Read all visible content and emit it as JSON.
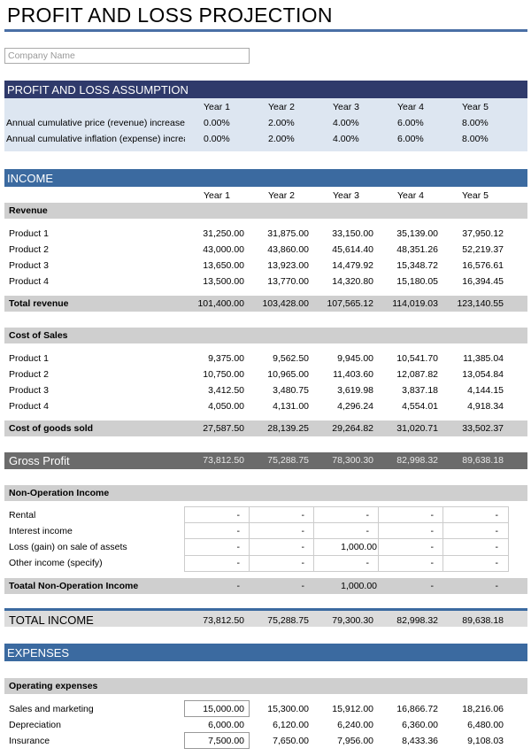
{
  "title": "PROFIT AND LOSS PROJECTION",
  "company_placeholder": "Company Name",
  "assumption": {
    "header": "PROFIT AND LOSS ASSUMPTION",
    "years": [
      "Year 1",
      "Year 2",
      "Year 3",
      "Year 4",
      "Year 5"
    ],
    "rows": [
      {
        "label": "Annual cumulative price (revenue) increase",
        "values": [
          "0.00%",
          "2.00%",
          "4.00%",
          "6.00%",
          "8.00%"
        ]
      },
      {
        "label": "Annual cumulative inflation (expense) increase",
        "values": [
          "0.00%",
          "2.00%",
          "4.00%",
          "6.00%",
          "8.00%"
        ]
      }
    ]
  },
  "income": {
    "header": "INCOME",
    "years": [
      "Year 1",
      "Year 2",
      "Year 3",
      "Year 4",
      "Year 5"
    ],
    "revenue_label": "Revenue",
    "revenue_rows": [
      {
        "label": "Product 1",
        "values": [
          "31,250.00",
          "31,875.00",
          "33,150.00",
          "35,139.00",
          "37,950.12"
        ]
      },
      {
        "label": "Product 2",
        "values": [
          "43,000.00",
          "43,860.00",
          "45,614.40",
          "48,351.26",
          "52,219.37"
        ]
      },
      {
        "label": "Product 3",
        "values": [
          "13,650.00",
          "13,923.00",
          "14,479.92",
          "15,348.72",
          "16,576.61"
        ]
      },
      {
        "label": "Product 4",
        "values": [
          "13,500.00",
          "13,770.00",
          "14,320.80",
          "15,180.05",
          "16,394.45"
        ]
      }
    ],
    "total_revenue": {
      "label": "Total revenue",
      "values": [
        "101,400.00",
        "103,428.00",
        "107,565.12",
        "114,019.03",
        "123,140.55"
      ]
    },
    "cost_label": "Cost of Sales",
    "cost_rows": [
      {
        "label": "Product 1",
        "values": [
          "9,375.00",
          "9,562.50",
          "9,945.00",
          "10,541.70",
          "11,385.04"
        ]
      },
      {
        "label": "Product 2",
        "values": [
          "10,750.00",
          "10,965.00",
          "11,403.60",
          "12,087.82",
          "13,054.84"
        ]
      },
      {
        "label": "Product 3",
        "values": [
          "3,412.50",
          "3,480.75",
          "3,619.98",
          "3,837.18",
          "4,144.15"
        ]
      },
      {
        "label": "Product 4",
        "values": [
          "4,050.00",
          "4,131.00",
          "4,296.24",
          "4,554.01",
          "4,918.34"
        ]
      }
    ],
    "cogs": {
      "label": "Cost of goods sold",
      "values": [
        "27,587.50",
        "28,139.25",
        "29,264.82",
        "31,020.71",
        "33,502.37"
      ]
    },
    "gross_profit": {
      "label": "Gross Profit",
      "values": [
        "73,812.50",
        "75,288.75",
        "78,300.30",
        "82,998.32",
        "89,638.18"
      ]
    },
    "nonop_label": "Non-Operation Income",
    "nonop_rows": [
      {
        "label": "Rental",
        "values": [
          "-",
          "-",
          "-",
          "-",
          "-"
        ]
      },
      {
        "label": "Interest income",
        "values": [
          "-",
          "-",
          "-",
          "-",
          "-"
        ]
      },
      {
        "label": "Loss (gain) on sale of assets",
        "values": [
          "-",
          "-",
          "1,000.00",
          "-",
          "-"
        ]
      },
      {
        "label": "Other income (specify)",
        "values": [
          "-",
          "-",
          "-",
          "-",
          "-"
        ]
      }
    ],
    "nonop_total": {
      "label": "Toatal Non-Operation Income",
      "values": [
        "-",
        "-",
        "1,000.00",
        "-",
        "-"
      ]
    },
    "total_income": {
      "label": "TOTAL INCOME",
      "values": [
        "73,812.50",
        "75,288.75",
        "79,300.30",
        "82,998.32",
        "89,638.18"
      ]
    }
  },
  "expenses": {
    "header": "EXPENSES",
    "opex_label": "Operating expenses",
    "rows": [
      {
        "label": "Sales and marketing",
        "values": [
          "15,000.00",
          "15,300.00",
          "15,912.00",
          "16,866.72",
          "18,216.06"
        ]
      },
      {
        "label": "Depreciation",
        "values": [
          "6,000.00",
          "6,120.00",
          "6,240.00",
          "6,360.00",
          "6,480.00"
        ]
      },
      {
        "label": "Insurance",
        "values": [
          "7,500.00",
          "7,650.00",
          "7,956.00",
          "8,433.36",
          "9,108.03"
        ]
      }
    ]
  }
}
